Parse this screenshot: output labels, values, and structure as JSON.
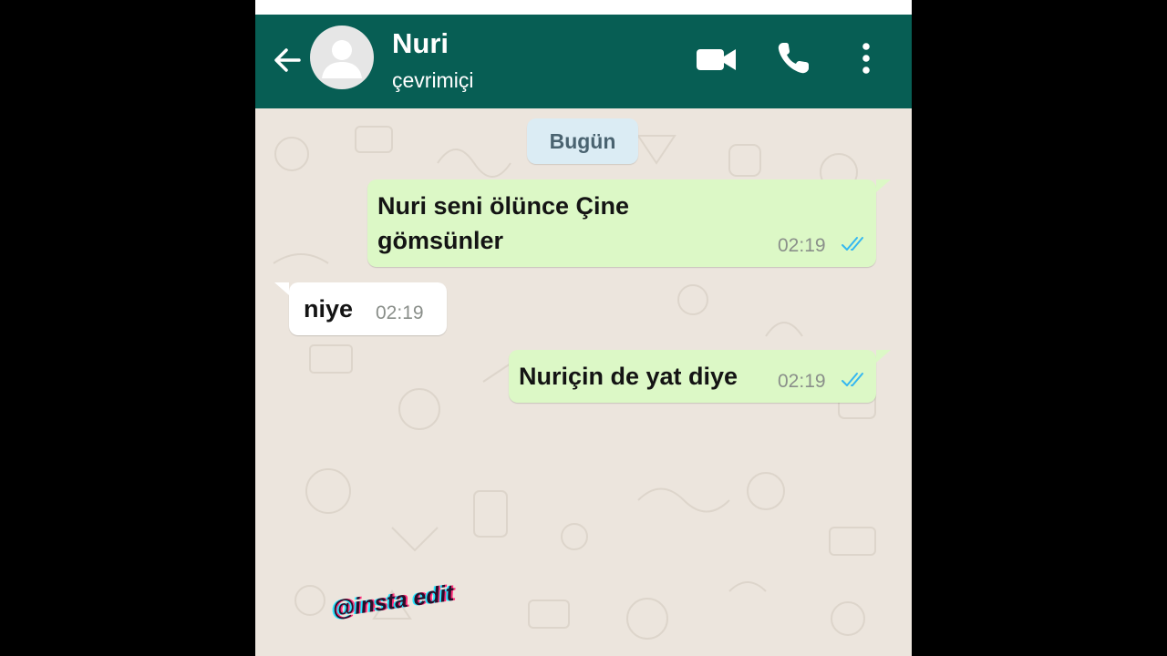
{
  "header": {
    "contact_name": "Nuri",
    "status": "çevrimiçi",
    "accent": "#075e54"
  },
  "icons": [
    "back-arrow-icon",
    "avatar-placeholder-icon",
    "video-call-icon",
    "phone-call-icon",
    "more-options-icon",
    "double-check-icon"
  ],
  "chat": {
    "date_label": "Bugün",
    "messages": [
      {
        "direction": "outgoing",
        "text_line1": "Nuri seni ölünce Çine",
        "text_line2": "gömsünler",
        "time": "02:19",
        "status": "read"
      },
      {
        "direction": "incoming",
        "text": "niye",
        "time": "02:19"
      },
      {
        "direction": "outgoing",
        "text": "Nuriçin de yat diye",
        "time": "02:19",
        "status": "read"
      }
    ],
    "colors": {
      "outgoing_bubble": "#dcf8c6",
      "incoming_bubble": "#ffffff",
      "read_ticks": "#34b7f1"
    }
  },
  "watermark": "@insta edit"
}
